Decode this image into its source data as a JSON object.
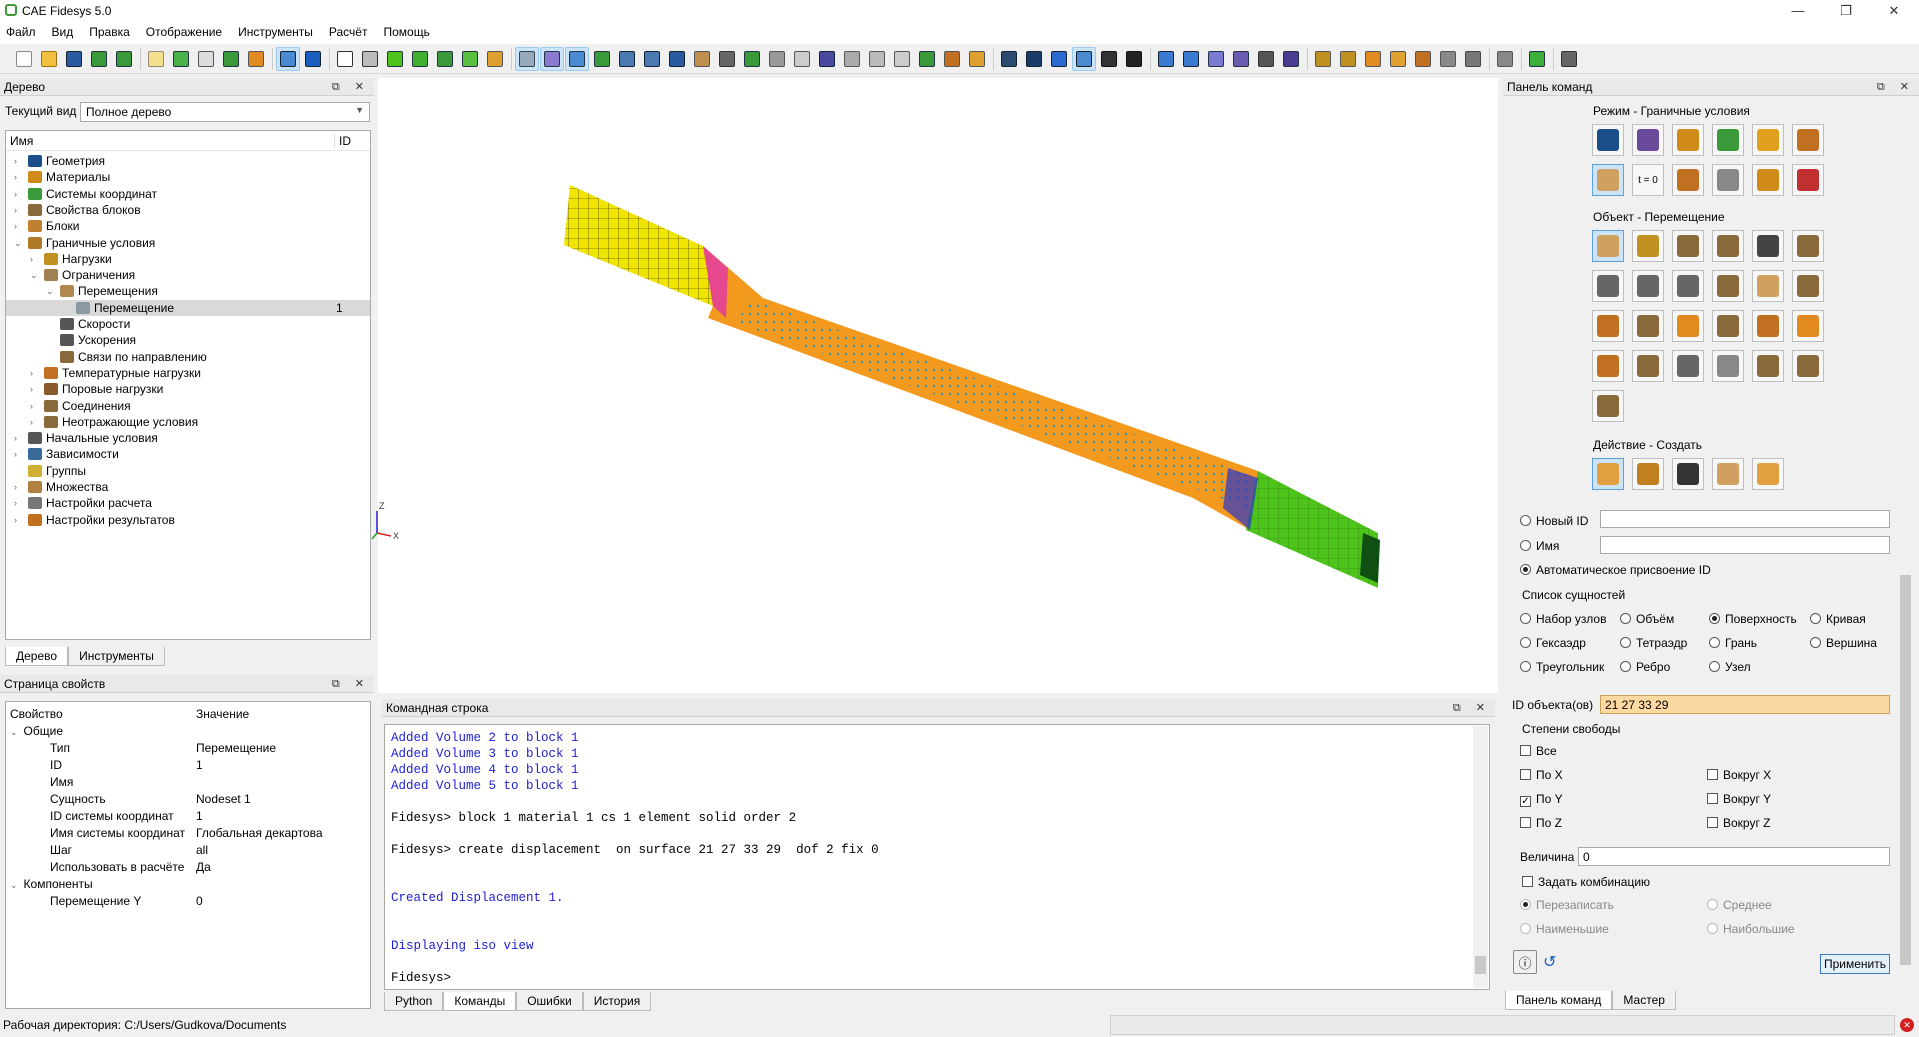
{
  "app": {
    "title": "CAE Fidesys 5.0"
  },
  "menu": [
    "Файл",
    "Вид",
    "Правка",
    "Отображение",
    "Инструменты",
    "Расчёт",
    "Помощь"
  ],
  "tree_panel": {
    "title": "Дерево",
    "view_label": "Текущий вид",
    "view_value": "Полное дерево",
    "col_name": "Имя",
    "col_id": "ID",
    "items": [
      {
        "label": "Геометрия",
        "level": 0,
        "expand": "›",
        "color": "#1a4f8a",
        "icon": "geometry-icon"
      },
      {
        "label": "Материалы",
        "level": 0,
        "expand": "›",
        "color": "#d08a1a",
        "icon": "materials-icon"
      },
      {
        "label": "Системы координат",
        "level": 0,
        "expand": "›",
        "color": "#3a9a3a",
        "icon": "coordinate-system-icon"
      },
      {
        "label": "Свойства блоков",
        "level": 0,
        "expand": "›",
        "color": "#8a6a3a",
        "icon": "block-properties-icon"
      },
      {
        "label": "Блоки",
        "level": 0,
        "expand": "›",
        "color": "#c08030",
        "icon": "blocks-icon"
      },
      {
        "label": "Граничные условия",
        "level": 0,
        "expand": "⌄",
        "color": "#b07a2a",
        "icon": "boundary-conditions-icon"
      },
      {
        "label": "Нагрузки",
        "level": 1,
        "expand": "›",
        "color": "#c09020",
        "icon": "loads-icon"
      },
      {
        "label": "Ограничения",
        "level": 1,
        "expand": "⌄",
        "color": "#a08050",
        "icon": "constraints-icon"
      },
      {
        "label": "Перемещения",
        "level": 2,
        "expand": "⌄",
        "color": "#b08850",
        "icon": "displacements-icon"
      },
      {
        "label": "Перемещение",
        "level": 3,
        "expand": "",
        "color": "#8a9aa0",
        "icon": "displacement-icon",
        "id": "1",
        "selected": true
      },
      {
        "label": "Скорости",
        "level": 2,
        "expand": "",
        "color": "#555",
        "icon": "velocity-icon"
      },
      {
        "label": "Ускорения",
        "level": 2,
        "expand": "",
        "color": "#555",
        "icon": "acceleration-icon"
      },
      {
        "label": "Связи по направлению",
        "level": 2,
        "expand": "",
        "color": "#8a6a3a",
        "icon": "directional-constraint-icon"
      },
      {
        "label": "Температурные нагрузки",
        "level": 1,
        "expand": "›",
        "color": "#c07020",
        "icon": "thermal-loads-icon"
      },
      {
        "label": "Поровые нагрузки",
        "level": 1,
        "expand": "›",
        "color": "#8a5a2a",
        "icon": "pore-loads-icon"
      },
      {
        "label": "Соединения",
        "level": 1,
        "expand": "›",
        "color": "#8a6a3a",
        "icon": "connections-icon"
      },
      {
        "label": "Неотражающие условия",
        "level": 1,
        "expand": "›",
        "color": "#8a6a3a",
        "icon": "nonreflecting-icon"
      },
      {
        "label": "Начальные условия",
        "level": 0,
        "expand": "›",
        "color": "#555",
        "icon": "initial-conditions-icon"
      },
      {
        "label": "Зависимости",
        "level": 0,
        "expand": "›",
        "color": "#3a6a9a",
        "icon": "dependencies-icon"
      },
      {
        "label": "Группы",
        "level": 0,
        "expand": "",
        "color": "#d0b030",
        "icon": "groups-icon"
      },
      {
        "label": "Множества",
        "level": 0,
        "expand": "›",
        "color": "#b08040",
        "icon": "sets-icon"
      },
      {
        "label": "Настройки расчета",
        "level": 0,
        "expand": "›",
        "color": "#777",
        "icon": "solver-settings-icon"
      },
      {
        "label": "Настройки результатов",
        "level": 0,
        "expand": "›",
        "color": "#c07020",
        "icon": "result-settings-icon"
      }
    ],
    "tabs": [
      "Дерево",
      "Инструменты"
    ]
  },
  "properties": {
    "title": "Страница свойств",
    "col_prop": "Свойство",
    "col_val": "Значение",
    "group_general": "Общие",
    "rows": [
      {
        "k": "Тип",
        "v": "Перемещение"
      },
      {
        "k": "ID",
        "v": "1"
      },
      {
        "k": "Имя",
        "v": ""
      },
      {
        "k": "Сущность",
        "v": "Nodeset 1"
      },
      {
        "k": "ID системы координат",
        "v": "1"
      },
      {
        "k": "Имя системы координат",
        "v": "Глобальная декартова"
      },
      {
        "k": "Шаг",
        "v": "all"
      },
      {
        "k": "Использовать в расчёте",
        "v": "Да"
      }
    ],
    "group_components": "Компоненты",
    "components": [
      {
        "k": "Перемещение Y",
        "v": "0"
      }
    ]
  },
  "viewport": {
    "axis_z": "Z",
    "axis_x": "X"
  },
  "console": {
    "title": "Командная строка",
    "lines": [
      {
        "t": "Added Volume 2 to block 1",
        "c": "blue"
      },
      {
        "t": "Added Volume 3 to block 1",
        "c": "blue"
      },
      {
        "t": "Added Volume 4 to block 1",
        "c": "blue"
      },
      {
        "t": "Added Volume 5 to block 1",
        "c": "blue"
      },
      {
        "t": "",
        "c": ""
      },
      {
        "t": "Fidesys> block 1 material 1 cs 1 element solid order 2",
        "c": "cmd"
      },
      {
        "t": "",
        "c": ""
      },
      {
        "t": "Fidesys> create displacement  on surface 21 27 33 29  dof 2 fix 0",
        "c": "cmd"
      },
      {
        "t": "",
        "c": ""
      },
      {
        "t": "",
        "c": ""
      },
      {
        "t": "Created Displacement 1.",
        "c": "blue"
      },
      {
        "t": "",
        "c": ""
      },
      {
        "t": "",
        "c": ""
      },
      {
        "t": "Displaying iso view",
        "c": "blue"
      },
      {
        "t": "",
        "c": ""
      },
      {
        "t": "Fidesys>",
        "c": "cmd"
      }
    ],
    "tabs": [
      "Python",
      "Команды",
      "Ошибки",
      "История"
    ]
  },
  "command_panel": {
    "title": "Панель команд",
    "mode_label": "Режим - Граничные условия",
    "object_label": "Объект - Перемещение",
    "action_label": "Действие - Создать",
    "t0_label": "t = 0",
    "new_id": "Новый ID",
    "name": "Имя",
    "auto_id": "Автоматическое присвоение ID",
    "entity_list": "Список сущностей",
    "entities": [
      "Набор узлов",
      "Объём",
      "Поверхность",
      "Кривая",
      "Гексаэдр",
      "Тетраэдр",
      "Грань",
      "Вершина",
      "Треугольник",
      "Ребро",
      "Узел"
    ],
    "object_ids_label": "ID объекта(ов)",
    "object_ids_value": "21 27 33 29",
    "dof_label": "Степени свободы",
    "dof_all": "Все",
    "dof": [
      "По X",
      "Вокруг X",
      "По Y",
      "Вокруг Y",
      "По Z",
      "Вокруг Z"
    ],
    "magnitude_label": "Величина",
    "magnitude_value": "0",
    "combine": "Задать комбинацию",
    "combine_opts": [
      "Перезаписать",
      "Среднее",
      "Наименьшие",
      "Наибольшие"
    ],
    "apply": "Применить",
    "tabs": [
      "Панель команд",
      "Мастер"
    ]
  },
  "status": {
    "workdir": "Рабочая директория: C:/Users/Gudkova/Documents"
  }
}
